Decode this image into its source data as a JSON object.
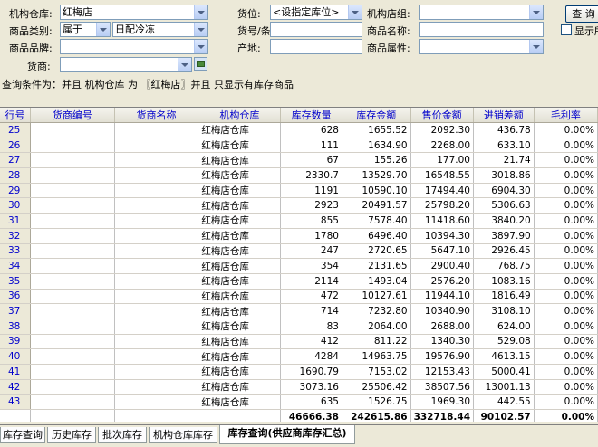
{
  "filters": {
    "org_warehouse": {
      "label": "机构仓库:",
      "value": "红梅店"
    },
    "location": {
      "label": "货位:",
      "value": "<设指定库位>"
    },
    "org_store_group": {
      "label": "机构店组:",
      "value": ""
    },
    "category": {
      "label": "商品类别:",
      "relation": "属于",
      "value": "日配冷冻"
    },
    "sku_barcode": {
      "label": "货号/条码:",
      "value": ""
    },
    "product_name": {
      "label": "商品名称:",
      "value": ""
    },
    "brand": {
      "label": "商品品牌:",
      "value": ""
    },
    "origin": {
      "label": "产地:",
      "value": ""
    },
    "attribute": {
      "label": "商品属性:",
      "value": ""
    },
    "supplier": {
      "label": "货商:",
      "value": ""
    },
    "query_button": "查 询",
    "show_checkbox_label": "显示所"
  },
  "condition_text": "查询条件为：并且 机构仓库 为 〖红梅店〗并且 只显示有库存商品",
  "table": {
    "columns": [
      "行号",
      "货商编号",
      "货商名称",
      "机构仓库",
      "库存数量",
      "库存金额",
      "售价金额",
      "进销差额",
      "毛利率"
    ],
    "rows": [
      [
        "25",
        "",
        "",
        "红梅店仓库",
        "628",
        "1655.52",
        "2092.30",
        "436.78",
        "0.00%"
      ],
      [
        "26",
        "",
        "",
        "红梅店仓库",
        "111",
        "1634.90",
        "2268.00",
        "633.10",
        "0.00%"
      ],
      [
        "27",
        "",
        "",
        "红梅店仓库",
        "67",
        "155.26",
        "177.00",
        "21.74",
        "0.00%"
      ],
      [
        "28",
        "",
        "",
        "红梅店仓库",
        "2330.7",
        "13529.70",
        "16548.55",
        "3018.86",
        "0.00%"
      ],
      [
        "29",
        "",
        "",
        "红梅店仓库",
        "1191",
        "10590.10",
        "17494.40",
        "6904.30",
        "0.00%"
      ],
      [
        "30",
        "",
        "",
        "红梅店仓库",
        "2923",
        "20491.57",
        "25798.20",
        "5306.63",
        "0.00%"
      ],
      [
        "31",
        "",
        "",
        "红梅店仓库",
        "855",
        "7578.40",
        "11418.60",
        "3840.20",
        "0.00%"
      ],
      [
        "32",
        "",
        "",
        "红梅店仓库",
        "1780",
        "6496.40",
        "10394.30",
        "3897.90",
        "0.00%"
      ],
      [
        "33",
        "",
        "",
        "红梅店仓库",
        "247",
        "2720.65",
        "5647.10",
        "2926.45",
        "0.00%"
      ],
      [
        "34",
        "",
        "",
        "红梅店仓库",
        "354",
        "2131.65",
        "2900.40",
        "768.75",
        "0.00%"
      ],
      [
        "35",
        "",
        "",
        "红梅店仓库",
        "2114",
        "1493.04",
        "2576.20",
        "1083.16",
        "0.00%"
      ],
      [
        "36",
        "",
        "",
        "红梅店仓库",
        "472",
        "10127.61",
        "11944.10",
        "1816.49",
        "0.00%"
      ],
      [
        "37",
        "",
        "",
        "红梅店仓库",
        "714",
        "7232.80",
        "10340.90",
        "3108.10",
        "0.00%"
      ],
      [
        "38",
        "",
        "",
        "红梅店仓库",
        "83",
        "2064.00",
        "2688.00",
        "624.00",
        "0.00%"
      ],
      [
        "39",
        "",
        "",
        "红梅店仓库",
        "412",
        "811.22",
        "1340.30",
        "529.08",
        "0.00%"
      ],
      [
        "40",
        "",
        "",
        "红梅店仓库",
        "4284",
        "14963.75",
        "19576.90",
        "4613.15",
        "0.00%"
      ],
      [
        "41",
        "",
        "",
        "红梅店仓库",
        "1690.79",
        "7153.02",
        "12153.43",
        "5000.41",
        "0.00%"
      ],
      [
        "42",
        "",
        "",
        "红梅店仓库",
        "3073.16",
        "25506.42",
        "38507.56",
        "13001.13",
        "0.00%"
      ],
      [
        "43",
        "",
        "",
        "红梅店仓库",
        "635",
        "1526.75",
        "1969.30",
        "442.55",
        "0.00%"
      ]
    ],
    "totals": [
      "",
      "",
      "",
      "",
      "46666.38",
      "242615.86",
      "332718.44",
      "90102.57",
      "0.00%"
    ]
  },
  "tabs": [
    "库存查询",
    "历史库存",
    "批次库存",
    "机构仓库库存",
    "库存查询(供应商库存汇总)"
  ],
  "active_tab": "库存查询(供应商库存汇总)"
}
